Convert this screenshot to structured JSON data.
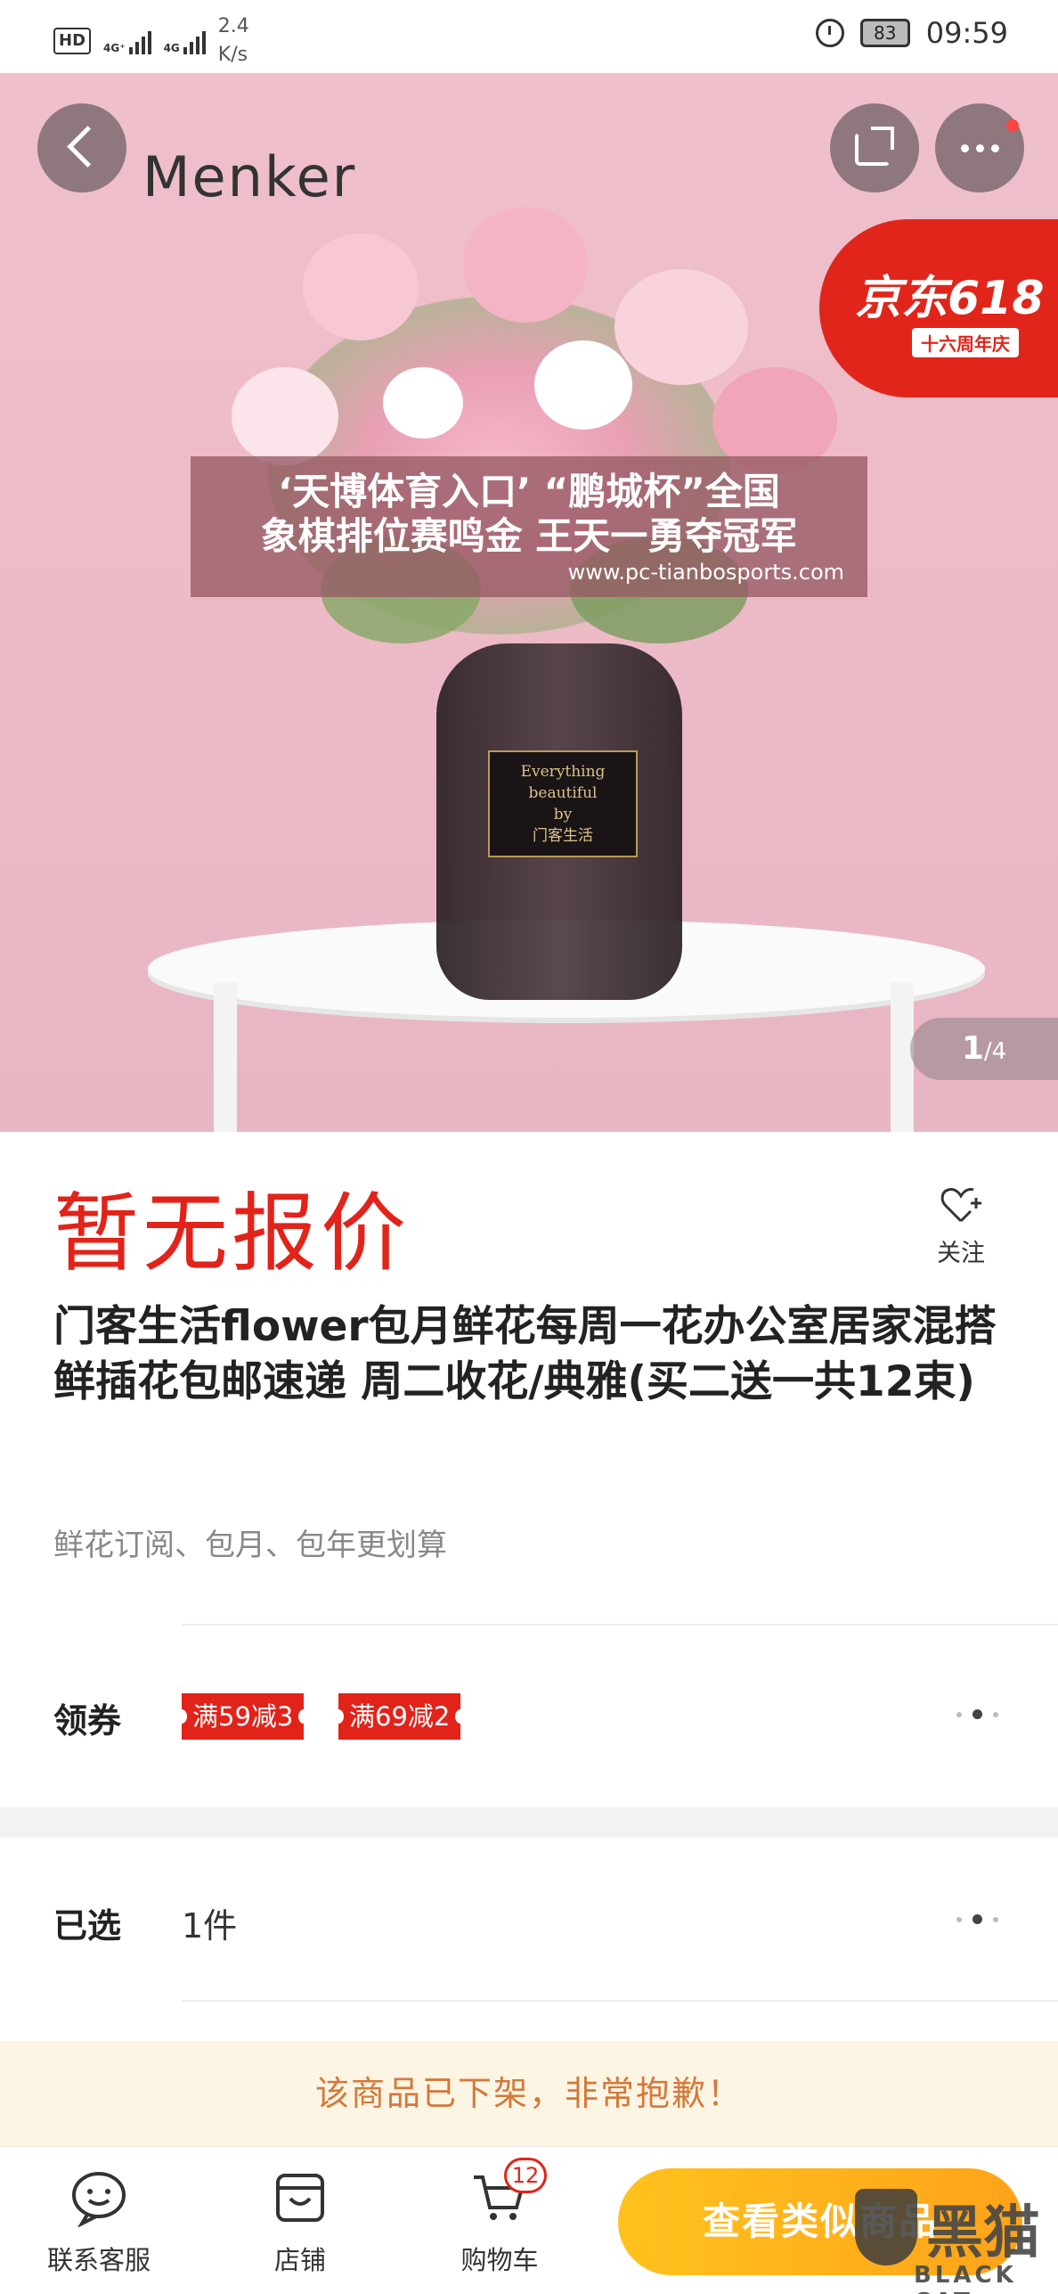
{
  "status_bar": {
    "hd": "HD",
    "net1": "4G⁺",
    "net2": "4G",
    "speed": "2.4\nK/s",
    "battery": "83",
    "time": "09:59"
  },
  "hero": {
    "brand": "Menker",
    "jd_main": "京东618",
    "jd_sub": "十六周年庆",
    "vase_label_1": "Everything beautiful",
    "vase_label_2": "by",
    "vase_label_3": "门客生活",
    "watermark_line1": "‘天博体育入口’ “鹏城杯”全国",
    "watermark_line2": "象棋排位赛鸣金 王天一勇夺冠军",
    "watermark_url": "www.pc-tianbosports.com",
    "pager_current": "1",
    "pager_total": "/4"
  },
  "product": {
    "price": "暂无报价",
    "follow_label": "关注",
    "title": "门客生活flower包月鲜花每周一花办公室居家混搭鲜插花包邮速递 周二收花/典雅(买二送一共12束)",
    "subtitle": "鲜花订阅、包月、包年更划算"
  },
  "coupons": {
    "label": "领券",
    "items": [
      "满59减3",
      "满69减2"
    ]
  },
  "selected": {
    "label": "已选",
    "value": "1件"
  },
  "notice": "该商品已下架，非常抱歉！",
  "bottom_bar": {
    "tabs": [
      {
        "label": "联系客服",
        "icon": "chat-face-icon"
      },
      {
        "label": "店铺",
        "icon": "store-icon"
      },
      {
        "label": "购物车",
        "icon": "cart-icon"
      }
    ],
    "cart_count": "12",
    "cta_label": "查看类似商品"
  },
  "watermark_logo": {
    "big": "黑猫",
    "small": "BLACK CAT"
  },
  "colors": {
    "price_red": "#e2231a",
    "cta_orange": "#ffb01c",
    "notice_text": "#d4793a",
    "notice_bg": "#fdf5e4"
  }
}
